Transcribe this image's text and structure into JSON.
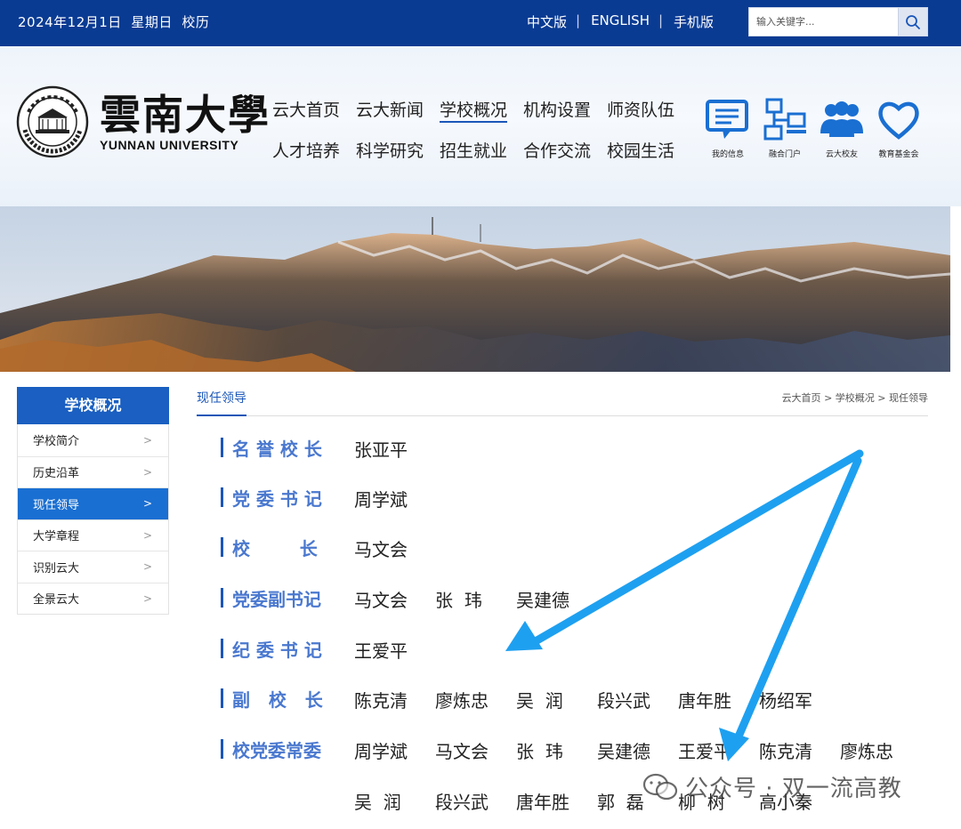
{
  "topbar": {
    "date": "2024年12月1日  星期日  校历",
    "langs": [
      "中文版",
      "ENGLISH",
      "手机版"
    ],
    "search_placeholder": "输入关键字..."
  },
  "logo": {
    "cn": "雲南大學",
    "en": "YUNNAN UNIVERSITY"
  },
  "nav": {
    "row1": [
      "云大首页",
      "云大新闻",
      "学校概况",
      "机构设置",
      "师资队伍"
    ],
    "row2": [
      "人才培养",
      "科学研究",
      "招生就业",
      "合作交流",
      "校园生活"
    ],
    "active": "学校概况"
  },
  "quick_links": [
    {
      "label": "我的信息",
      "icon": "message-board-icon"
    },
    {
      "label": "融合门户",
      "icon": "network-portal-icon"
    },
    {
      "label": "云大校友",
      "icon": "alumni-group-icon"
    },
    {
      "label": "教育基金会",
      "icon": "heart-foundation-icon"
    }
  ],
  "sidebar": {
    "title": "学校概况",
    "items": [
      {
        "label": "学校简介",
        "arrow": ">"
      },
      {
        "label": "历史沿革",
        "arrow": ">"
      },
      {
        "label": "现任领导",
        "arrow": ">"
      },
      {
        "label": "大学章程",
        "arrow": ">"
      },
      {
        "label": "识别云大",
        "arrow": ">"
      },
      {
        "label": "全景云大",
        "arrow": ">"
      }
    ],
    "active_index": 2
  },
  "main": {
    "page_title": "现任领导",
    "breadcrumb": [
      "云大首页",
      "学校概况",
      "现任领导"
    ],
    "breadcrumb_sep": ">"
  },
  "leaders": [
    {
      "role": "名 誉 校 长",
      "names": [
        "张亚平"
      ]
    },
    {
      "role": "党 委 书 记",
      "names": [
        "周学斌"
      ]
    },
    {
      "role": "校        长",
      "names": [
        "马文会"
      ]
    },
    {
      "role": "党委副书记",
      "names": [
        "马文会",
        "张  玮",
        "吴建德"
      ]
    },
    {
      "role": "纪 委 书 记",
      "names": [
        "王爱平"
      ]
    },
    {
      "role": "副   校   长",
      "names": [
        "陈克清",
        "廖炼忠",
        "吴  润",
        "段兴武",
        "唐年胜",
        "杨绍军"
      ]
    },
    {
      "role": "校党委常委",
      "names": [
        "周学斌",
        "马文会",
        "张  玮",
        "吴建德",
        "王爱平",
        "陈克清",
        "廖炼忠"
      ]
    }
  ],
  "leaders_continued": [
    "吴  润",
    "段兴武",
    "唐年胜",
    "郭  磊",
    "柳  树",
    "高小秦"
  ],
  "watermark": "公众号 · 双一流高教",
  "colors": {
    "topbar": "#0a3b93",
    "accent": "#1a56b8",
    "role": "#4a78cf",
    "arrow": "#1ea0f0"
  }
}
